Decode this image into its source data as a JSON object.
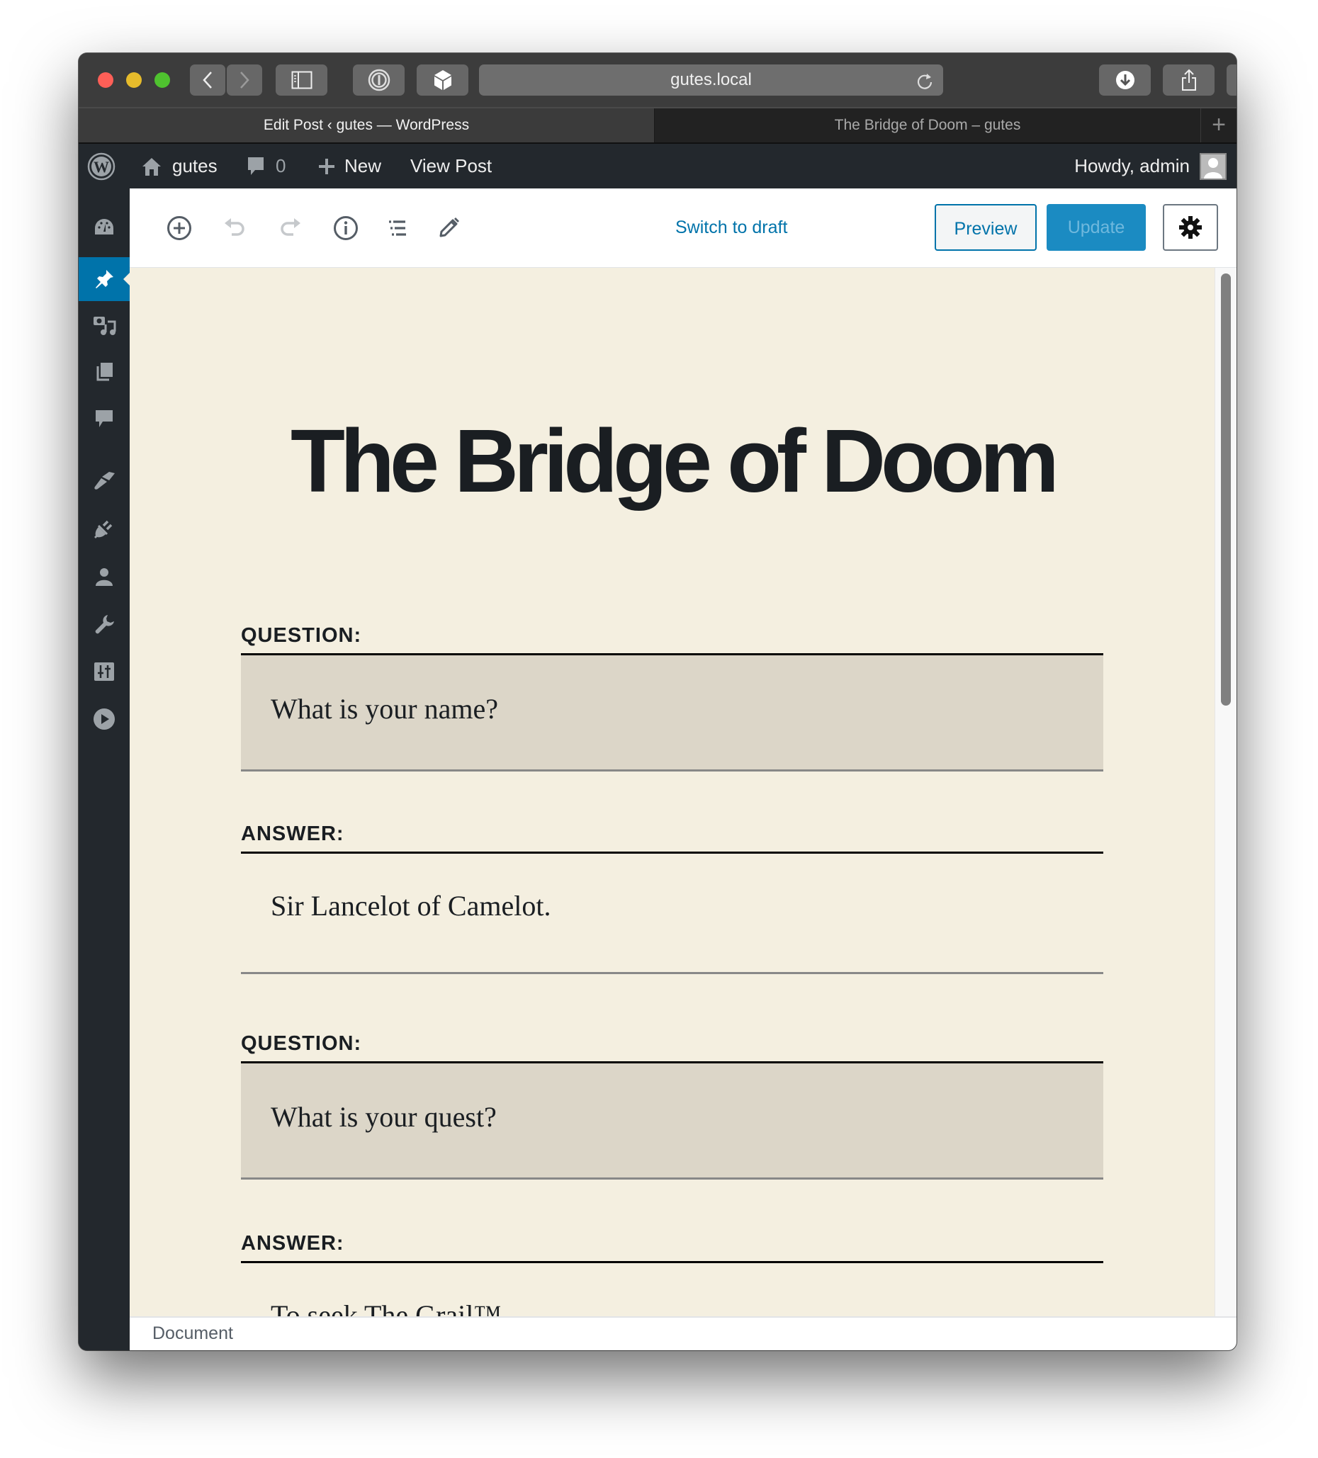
{
  "browser": {
    "url": "gutes.local",
    "tabs": [
      {
        "label": "Edit Post ‹ gutes — WordPress",
        "active": true
      },
      {
        "label": "The Bridge of Doom – gutes",
        "active": false
      }
    ],
    "new_tab_label": "+"
  },
  "admin_bar": {
    "site_name": "gutes",
    "comments_count": "0",
    "new_label": "New",
    "view_post_label": "View Post",
    "howdy_label": "Howdy, admin"
  },
  "sidebar": {
    "items": [
      {
        "name": "dashboard",
        "active": false
      },
      {
        "name": "posts",
        "active": true
      },
      {
        "name": "media",
        "active": false
      },
      {
        "name": "pages",
        "active": false
      },
      {
        "name": "comments",
        "active": false
      },
      {
        "name": "appearance",
        "active": false
      },
      {
        "name": "plugins",
        "active": false
      },
      {
        "name": "users",
        "active": false
      },
      {
        "name": "tools",
        "active": false
      },
      {
        "name": "settings",
        "active": false
      },
      {
        "name": "media-player",
        "active": false
      }
    ]
  },
  "editor_header": {
    "switch_to_draft_label": "Switch to draft",
    "preview_label": "Preview",
    "update_label": "Update"
  },
  "post": {
    "title": "The Bridge of Doom",
    "blocks": [
      {
        "label": "QUESTION:",
        "text": "What is your name?",
        "type": "question"
      },
      {
        "label": "ANSWER:",
        "text": "Sir Lancelot of Camelot.",
        "type": "answer"
      },
      {
        "label": "QUESTION:",
        "text": "What is your quest?",
        "type": "question"
      },
      {
        "label": "ANSWER:",
        "text": "To seek The Grail™.",
        "type": "answer"
      }
    ]
  },
  "footer": {
    "breadcrumb": "Document"
  },
  "colors": {
    "accent": "#0073aa",
    "update_button": "#1b8bc2",
    "content_bg": "#f4efe0",
    "question_bg": "#dcd6c8",
    "admin_bar_bg": "#23282d"
  }
}
